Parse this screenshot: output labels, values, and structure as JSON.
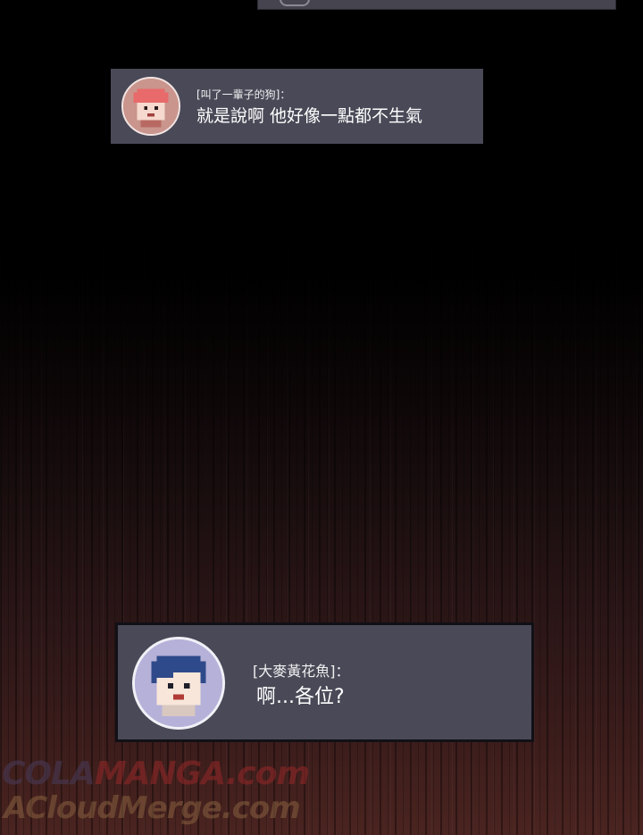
{
  "chat": [
    {
      "speaker": "[叫了一輩子的狗]：",
      "message": "就是說啊 他好像一點都不生氣",
      "avatar_icon": "red-hair-pixel-avatar-icon",
      "avatar_color": "#c9958d"
    },
    {
      "speaker": "[大麥黃花魚]：",
      "message": "啊...各位?",
      "avatar_icon": "blue-hair-pixel-avatar-icon",
      "avatar_color": "#b6b1d8"
    }
  ],
  "watermark": {
    "line1_part1": "COLA",
    "line1_part2": "MANGA",
    "line1_part3": ".com",
    "line2": "ACloudMerge.com"
  },
  "colors": {
    "chat_box": "#4a4957",
    "background_top": "#000000",
    "background_bottom": "#4a2420"
  }
}
